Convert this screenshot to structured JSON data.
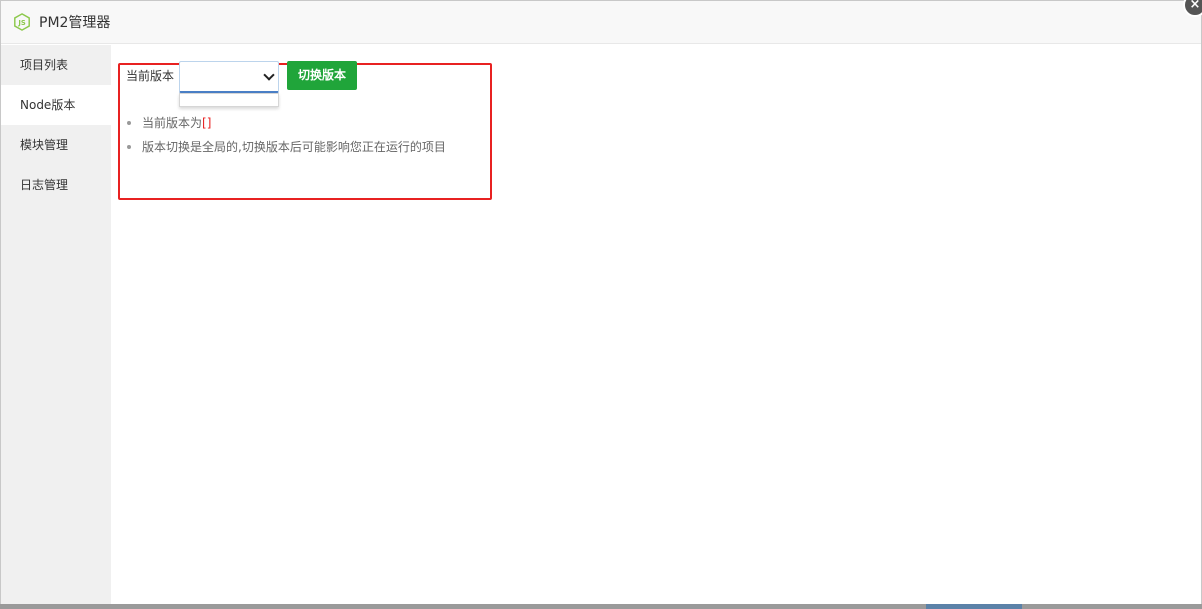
{
  "window": {
    "title": "PM2管理器",
    "logo_icon": "nodejs-logo-icon",
    "close_icon": "close-icon",
    "close_label": "×"
  },
  "sidebar": {
    "items": [
      {
        "label": "项目列表",
        "active": false
      },
      {
        "label": "Node版本",
        "active": true
      },
      {
        "label": "模块管理",
        "active": false
      },
      {
        "label": "日志管理",
        "active": false
      }
    ]
  },
  "main": {
    "version_label": "当前版本",
    "version_select_value": "",
    "switch_button_label": "切换版本",
    "notes": {
      "current_prefix": "当前版本为",
      "current_value": "[]",
      "warning": "版本切换是全局的,切换版本后可能影响您正在运行的项目"
    }
  },
  "colors": {
    "accent_green": "#20a53a",
    "highlight_red": "#e82121",
    "sidebar_bg": "#f0f0f0"
  }
}
